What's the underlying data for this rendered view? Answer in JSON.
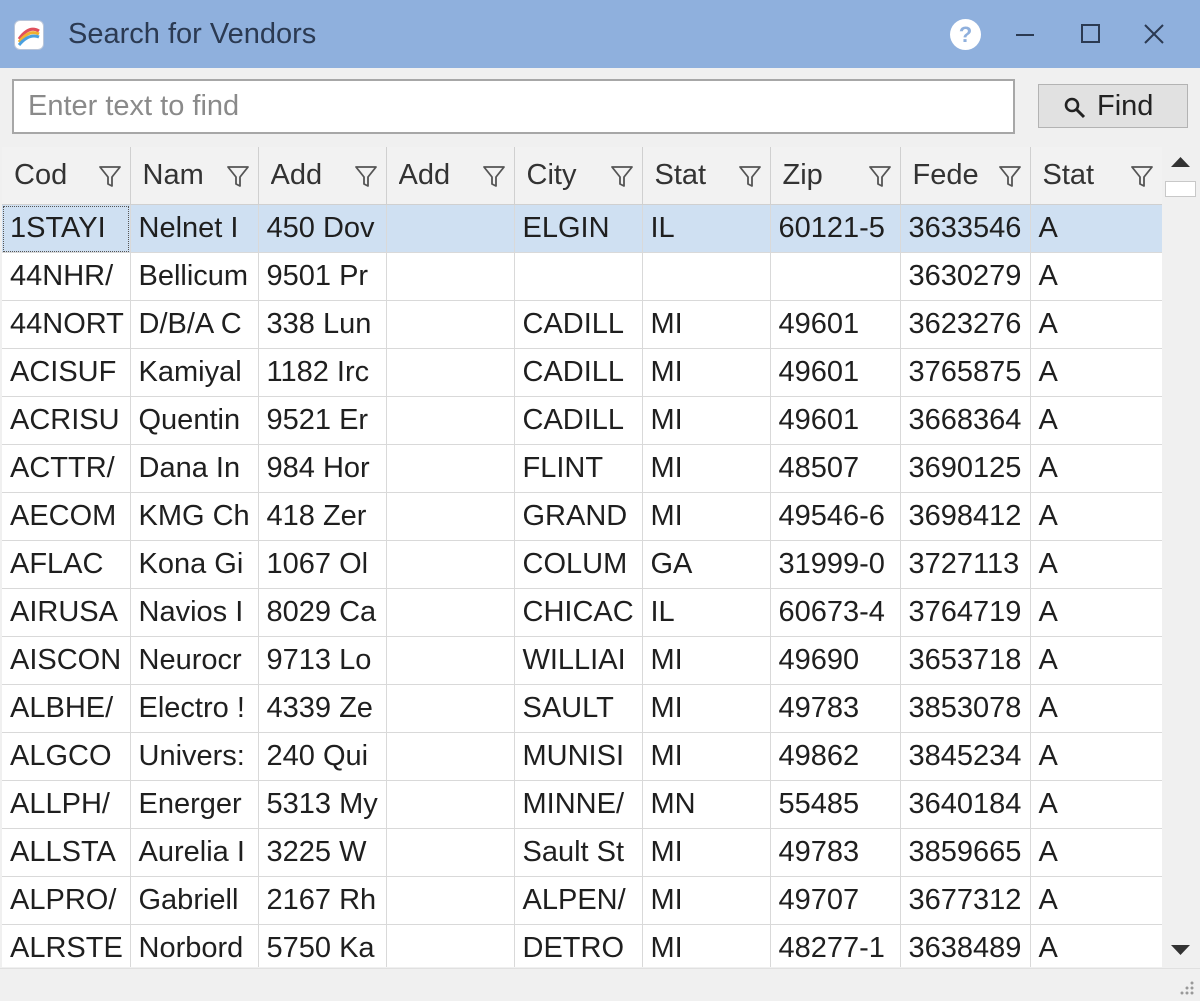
{
  "window": {
    "title": "Search for Vendors",
    "help_label": "?",
    "icons": [
      "app-icon",
      "help-icon",
      "minimize-icon",
      "maximize-icon",
      "close-icon"
    ],
    "accent_color": "#8fb0dd"
  },
  "search": {
    "placeholder": "Enter text to find",
    "value": "",
    "find_label": "Find",
    "find_icon": "search-icon"
  },
  "grid": {
    "columns": [
      {
        "label": "Cod",
        "filter_icon": "filter-icon"
      },
      {
        "label": "Nam",
        "filter_icon": "filter-icon"
      },
      {
        "label": "Add",
        "filter_icon": "filter-icon"
      },
      {
        "label": "Add",
        "filter_icon": "filter-icon"
      },
      {
        "label": "City",
        "filter_icon": "filter-icon"
      },
      {
        "label": "Stat",
        "filter_icon": "filter-icon"
      },
      {
        "label": "Zip",
        "filter_icon": "filter-icon"
      },
      {
        "label": "Fede",
        "filter_icon": "filter-icon"
      },
      {
        "label": "Stat",
        "filter_icon": "filter-icon"
      }
    ],
    "selected_row_color": "#cfe0f2",
    "rows": [
      [
        "1STAYI",
        "Nelnet I",
        "450 Dov",
        "",
        "ELGIN",
        "IL",
        "60121-5",
        "3633546",
        "A"
      ],
      [
        "44NHR/",
        "Bellicum",
        "9501 Pr",
        "",
        "",
        "",
        "",
        "3630279",
        "A"
      ],
      [
        "44NORT",
        "D/B/A C",
        "338 Lun",
        "",
        "CADILL",
        "MI",
        "49601",
        "3623276",
        "A"
      ],
      [
        "ACISUF",
        "Kamiyal",
        "1182 Irc",
        "",
        "CADILL",
        "MI",
        "49601",
        "3765875",
        "A"
      ],
      [
        "ACRISU",
        "Quentin",
        "9521 Er",
        "",
        "CADILL",
        "MI",
        "49601",
        "3668364",
        "A"
      ],
      [
        "ACTTR/",
        "Dana In",
        "984 Hor",
        "",
        "FLINT",
        "MI",
        "48507",
        "3690125",
        "A"
      ],
      [
        "AECOM",
        "KMG Ch",
        "418 Zer",
        "",
        "GRAND",
        "MI",
        "49546-6",
        "3698412",
        "A"
      ],
      [
        "AFLAC",
        "Kona Gi",
        "1067 Ol",
        "",
        "COLUM",
        "GA",
        "31999-0",
        "3727113",
        "A"
      ],
      [
        "AIRUSA",
        "Navios I",
        "8029 Ca",
        "",
        "CHICAC",
        "IL",
        "60673-4",
        "3764719",
        "A"
      ],
      [
        "AISCON",
        "Neurocr",
        "9713 Lo",
        "",
        "WILLIAI",
        "MI",
        "49690",
        "3653718",
        "A"
      ],
      [
        "ALBHE/",
        "Electro !",
        "4339 Ze",
        "",
        "SAULT",
        "MI",
        "49783",
        "3853078",
        "A"
      ],
      [
        "ALGCO",
        "Univers:",
        "240 Qui",
        "",
        "MUNISI",
        "MI",
        "49862",
        "3845234",
        "A"
      ],
      [
        "ALLPH/",
        "Energer",
        "5313 My",
        "",
        "MINNE/",
        "MN",
        "55485",
        "3640184",
        "A"
      ],
      [
        "ALLSTA",
        "Aurelia I",
        "3225 W",
        "",
        "Sault St",
        "MI",
        "49783",
        "3859665",
        "A"
      ],
      [
        "ALPRO/",
        "Gabriell",
        "2167 Rh",
        "",
        "ALPEN/",
        "MI",
        "49707",
        "3677312",
        "A"
      ],
      [
        "ALRSTE",
        "Norbord",
        "5750 Ka",
        "",
        "DETRO",
        "MI",
        "48277-1",
        "3638489",
        "A"
      ]
    ]
  },
  "scrollbar": {
    "up_icon": "scroll-up-arrow-icon",
    "down_icon": "scroll-down-arrow-icon"
  }
}
